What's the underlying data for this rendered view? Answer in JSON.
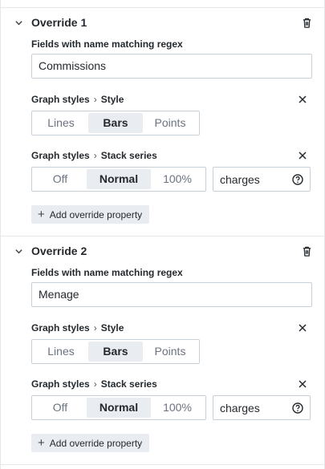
{
  "overrides": [
    {
      "title": "Override 1",
      "matcher_label": "Fields with name matching regex",
      "matcher_value": "Commissions",
      "style_prop": {
        "category": "Graph styles",
        "name": "Style",
        "options": [
          "Lines",
          "Bars",
          "Points"
        ],
        "selected": "Bars"
      },
      "stack_prop": {
        "category": "Graph styles",
        "name": "Stack series",
        "options": [
          "Off",
          "Normal",
          "100%"
        ],
        "selected": "Normal",
        "group_value": "charges"
      },
      "add_label": "Add override property"
    },
    {
      "title": "Override 2",
      "matcher_label": "Fields with name matching regex",
      "matcher_value": "Menage",
      "style_prop": {
        "category": "Graph styles",
        "name": "Style",
        "options": [
          "Lines",
          "Bars",
          "Points"
        ],
        "selected": "Bars"
      },
      "stack_prop": {
        "category": "Graph styles",
        "name": "Stack series",
        "options": [
          "Off",
          "Normal",
          "100%"
        ],
        "selected": "Normal",
        "group_value": "charges"
      },
      "add_label": "Add override property"
    }
  ],
  "icons": {
    "collapse": "chevron-down-icon",
    "delete": "trash-icon",
    "remove": "close-icon",
    "separator": "chevron-right-icon",
    "help": "question-circle-icon",
    "add": "plus-icon"
  }
}
